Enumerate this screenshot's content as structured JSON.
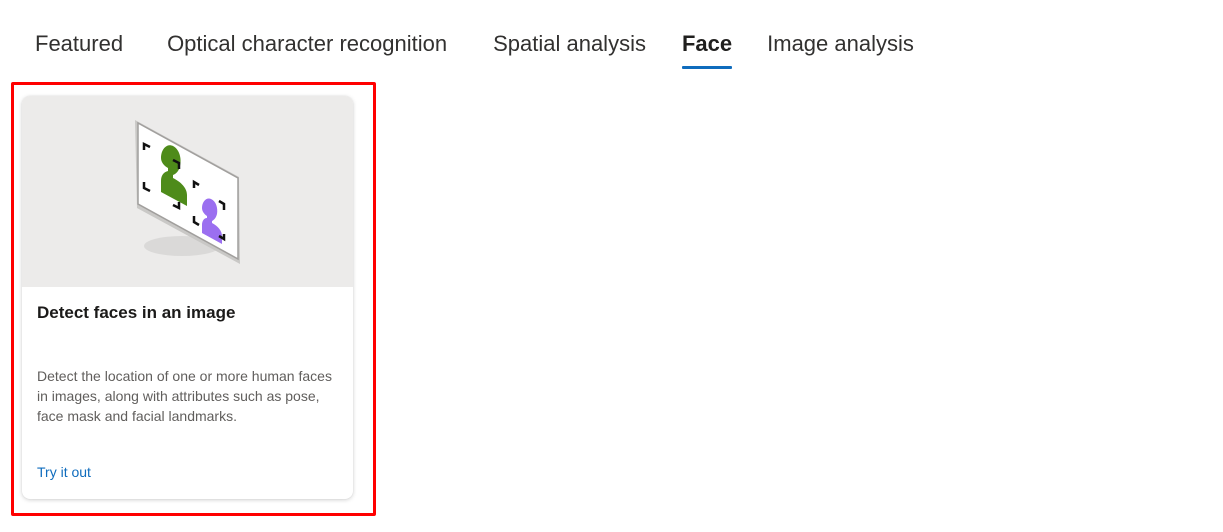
{
  "tabs": [
    {
      "label": "Featured",
      "active": false
    },
    {
      "label": "Optical character recognition",
      "active": false
    },
    {
      "label": "Spatial analysis",
      "active": false
    },
    {
      "label": "Face",
      "active": true
    },
    {
      "label": "Image analysis",
      "active": false
    }
  ],
  "card": {
    "illustration_icon": "face-detection-illustration",
    "title": "Detect faces in an image",
    "description": "Detect the location of one or more human faces in images, along with attributes such as pose, face mask and facial landmarks.",
    "link_label": "Try it out"
  },
  "colors": {
    "accent": "#0f6cbd",
    "highlight": "#ff0000",
    "hero_background": "#ecebea",
    "face_green": "#4e8b1a",
    "face_purple": "#9b6ff0"
  }
}
